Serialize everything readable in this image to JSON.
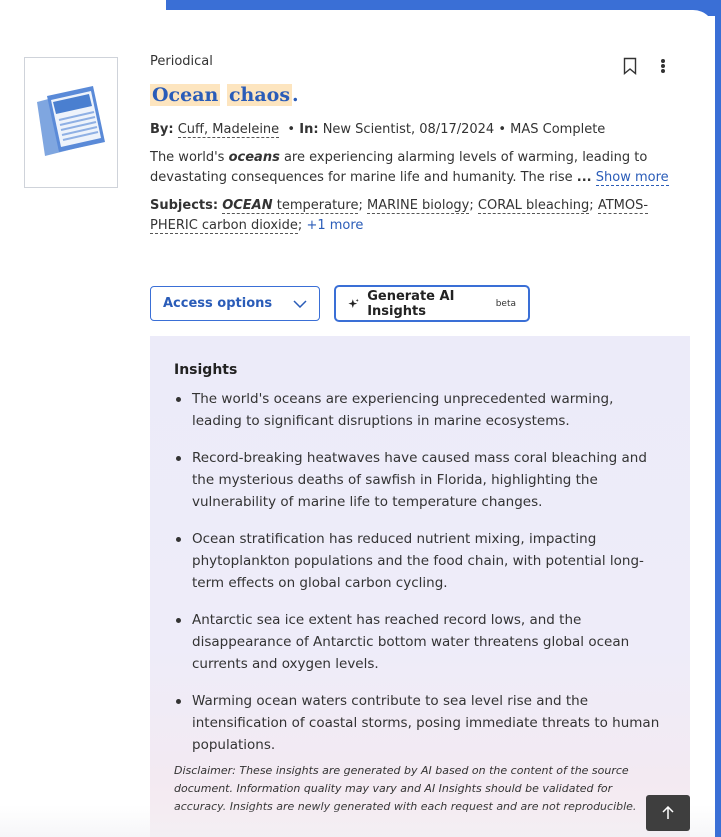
{
  "record": {
    "type": "Periodical",
    "title_word1": "Ocean",
    "title_word2": "chaos",
    "title_end": ".",
    "by_label": "By:",
    "author": "Cuff, Madeleine",
    "in_label": "In:",
    "source": "New Scientist, 08/17/2024",
    "database": "MAS Complete",
    "abstract_pre": "The world's ",
    "abstract_term": "oceans",
    "abstract_post": " are experiencing alarming levels of warming, leading to devastating consequences for marine life and humanity. The rise",
    "ellipsis": "...",
    "show_more": "Show more",
    "subjects_label": "Subjects:",
    "subjects": [
      {
        "bold": "OCEAN",
        "rest": " temperature"
      },
      {
        "bold": "",
        "rest": "MARINE biology"
      },
      {
        "bold": "",
        "rest": "CORAL bleaching"
      },
      {
        "bold": "",
        "rest": "ATMOS-PHERIC carbon dioxide"
      }
    ],
    "more_subjects": "+1 more"
  },
  "actions": {
    "access_label": "Access options",
    "ai_label": "Generate AI Insights",
    "ai_badge": "beta"
  },
  "insights": {
    "heading": "Insights",
    "items": [
      "The world's oceans are experiencing unprecedented warming, leading to significant disruptions in marine ecosystems.",
      "Record-breaking heatwaves have caused mass coral bleaching and the mysterious deaths of sawfish in Florida, highlighting the vulnerability of marine life to temperature changes.",
      "Ocean stratification has reduced nutrient mixing, impacting phytoplankton populations and the food chain, with potential long-term effects on global carbon cycling.",
      "Antarctic sea ice extent has reached record lows, and the disappearance of Antarctic bottom water threatens global ocean currents and oxygen levels.",
      "Warming ocean waters contribute to sea level rise and the intensification of coastal storms, posing immediate threats to human populations."
    ],
    "disclaimer": "Disclaimer: These insights are generated by AI based on the content of the source document. Information quality may vary and AI Insights should be validated for accuracy. Insights are newly generated with each request and are not reproducible."
  },
  "icons": {
    "bookmark": "bookmark-icon",
    "more": "more-vertical-icon",
    "chevron": "chevron-down-icon",
    "sparkle": "sparkle-icon",
    "scroll_top": "arrow-up-icon",
    "thumbnail": "periodical-icon"
  },
  "colors": {
    "accent": "#3a6fd6",
    "link": "#2a5cb8",
    "highlight": "#fde5bf",
    "insights_bg": "#ecebf9"
  }
}
